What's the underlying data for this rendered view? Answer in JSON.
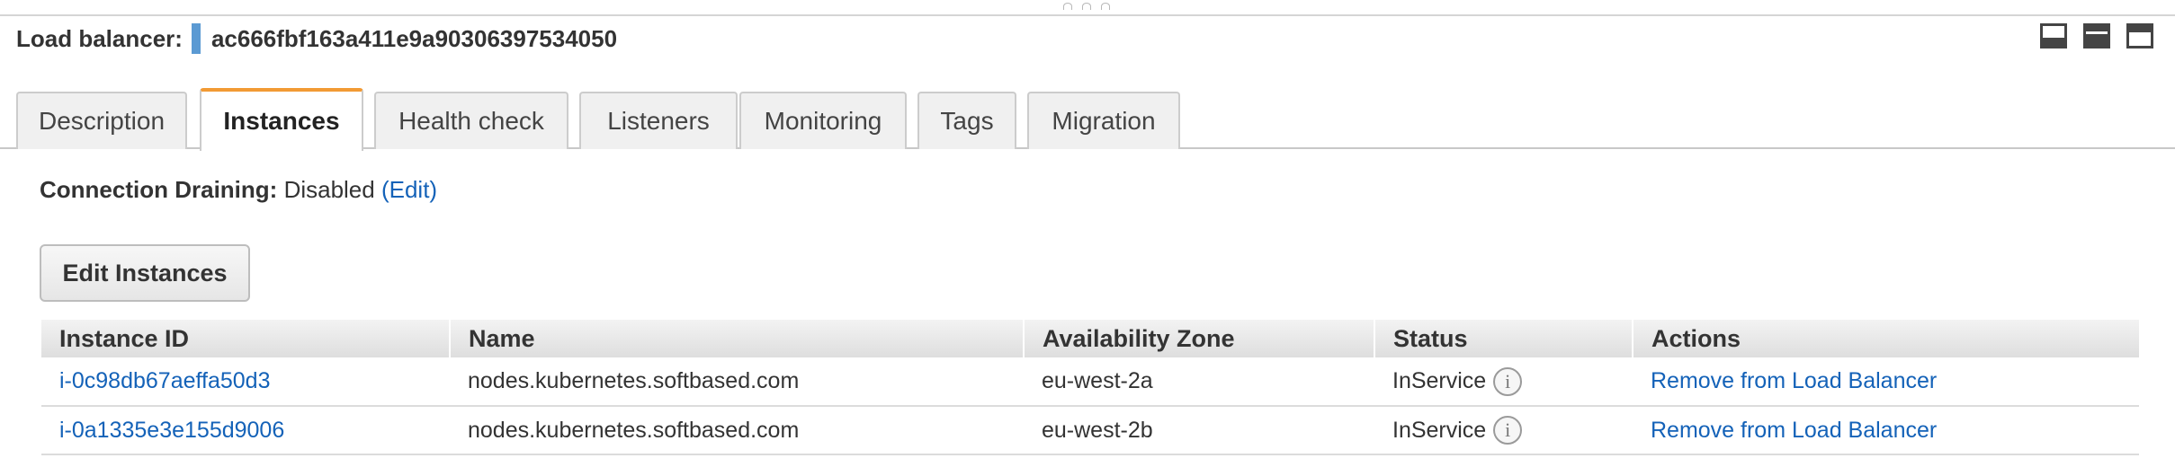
{
  "header": {
    "label": "Load balancer:",
    "name": "ac666fbf163a411e9a90306397534050"
  },
  "tabs": [
    {
      "label": "Description",
      "active": false
    },
    {
      "label": "Instances",
      "active": true
    },
    {
      "label": "Health check",
      "active": false
    },
    {
      "label": "Listeners",
      "active": false
    },
    {
      "label": "Monitoring",
      "active": false
    },
    {
      "label": "Tags",
      "active": false
    },
    {
      "label": "Migration",
      "active": false
    }
  ],
  "connection_draining": {
    "label": "Connection Draining:",
    "value": "Disabled",
    "edit_link": "(Edit)"
  },
  "edit_instances_button": "Edit Instances",
  "table": {
    "columns": [
      "Instance ID",
      "Name",
      "Availability Zone",
      "Status",
      "Actions"
    ],
    "rows": [
      {
        "instance_id": "i-0c98db67aeffa50d3",
        "name": "nodes.kubernetes.softbased.com",
        "zone": "eu-west-2a",
        "status": "InService",
        "action": "Remove from Load Balancer"
      },
      {
        "instance_id": "i-0a1335e3e155d9006",
        "name": "nodes.kubernetes.softbased.com",
        "zone": "eu-west-2b",
        "status": "InService",
        "action": "Remove from Load Balancer"
      }
    ]
  },
  "icons": {
    "info": "i",
    "accent_active_tab": "#f29a34",
    "link_color": "#1462b8"
  }
}
